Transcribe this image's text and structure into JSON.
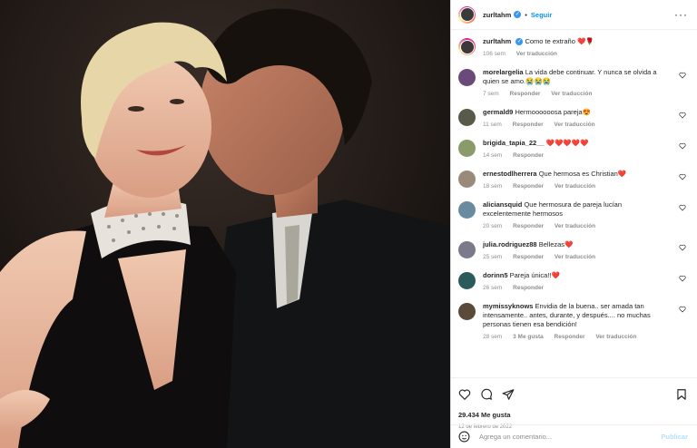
{
  "post": {
    "username": "zurltahm",
    "follow_label": "Seguir",
    "more_label": "···",
    "caption": "Como te extraño",
    "caption_emoji": "❤️🌹",
    "caption_time": "106 sem",
    "caption_translate": "Ver traducción"
  },
  "comments": [
    {
      "user": "morelargelia",
      "text": "La vida debe continuar. Y nunca se olvida a quien se amo.😭😭😭",
      "time": "7 sem",
      "reply": "Responder",
      "translate": "Ver traducción",
      "likes": "",
      "avatar_color": "#6a4a7a"
    },
    {
      "user": "germald9",
      "text": "Hermoooooosa pareja😍",
      "time": "11 sem",
      "reply": "Responder",
      "translate": "Ver traducción",
      "likes": "",
      "avatar_color": "#5a5a4a"
    },
    {
      "user": "brigida_tapia_22__",
      "text": "❤️❤️❤️❤️❤️",
      "time": "14 sem",
      "reply": "Responder",
      "translate": "",
      "likes": "",
      "avatar_color": "#8a9a6a"
    },
    {
      "user": "ernestodlherrera",
      "text": "Que hermosa es Christian❤️",
      "time": "18 sem",
      "reply": "Responder",
      "translate": "Ver traducción",
      "likes": "",
      "avatar_color": "#9a8a7a"
    },
    {
      "user": "aliciansquid",
      "text": "Que hermosura de pareja lucían excelentemente hermosos",
      "time": "20 sem",
      "reply": "Responder",
      "translate": "Ver traducción",
      "likes": "",
      "avatar_color": "#6a8aa0"
    },
    {
      "user": "julia.rodriguez88",
      "text": "Bellezas❤️",
      "time": "25 sem",
      "reply": "Responder",
      "translate": "Ver traducción",
      "likes": "",
      "avatar_color": "#7a7a8a"
    },
    {
      "user": "dorinn5",
      "text": "Pareja única!!❤️",
      "time": "26 sem",
      "reply": "Responder",
      "translate": "",
      "likes": "",
      "avatar_color": "#2a5a5a"
    },
    {
      "user": "mymissyknows",
      "text": "Envidia de la buena.. ser amada tan intensamente.. antes, durante, y después.... no muchas personas tienen esa bendición!",
      "time": "28 sem",
      "reply": "Responder",
      "translate": "Ver traducción",
      "likes": "3 Me gusta",
      "avatar_color": "#5a4a3a"
    }
  ],
  "actions": {
    "likes": "29.434 Me gusta",
    "date": "12 de febrero de 2022"
  },
  "add_comment": {
    "placeholder": "Agrega un comentario...",
    "publish_label": "Publicar"
  },
  "colors": {
    "accent": "#0095f6",
    "heart": "#ed4956",
    "muted": "#8e8e8e"
  }
}
